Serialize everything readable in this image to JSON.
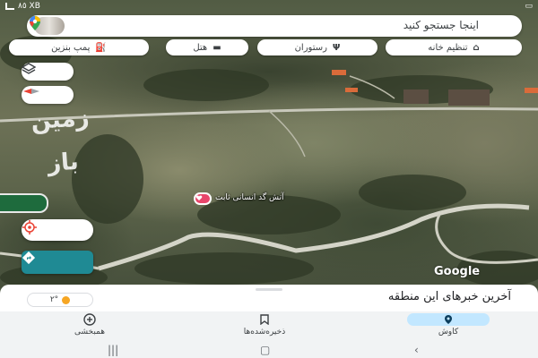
{
  "status_bar": {
    "left_text": "٨٥ XB"
  },
  "search": {
    "placeholder": "اینجا جستجو کنید"
  },
  "chips": [
    {
      "label": "تنظیم خانه",
      "icon": "home-icon"
    },
    {
      "label": "رستوران",
      "icon": "restaurant-icon"
    },
    {
      "label": "هتل",
      "icon": "hotel-icon"
    },
    {
      "label": "پمپ بنزین",
      "icon": "gas-station-icon"
    }
  ],
  "map": {
    "watermark": "زمین باز",
    "place_label": "آتش گد انسانی ثابت",
    "google_wordmark": "Google"
  },
  "sheet": {
    "title": "آخرین خبرهای این منطقه",
    "weather": "۲°"
  },
  "nav": {
    "explore": "کاوش",
    "saved": "ذخیره‌شده‌ها",
    "contribute": "همبخشی"
  },
  "colors": {
    "accent": "#1f8a94",
    "nav_active": "#c2e7ff",
    "marker": "#e8466b"
  }
}
